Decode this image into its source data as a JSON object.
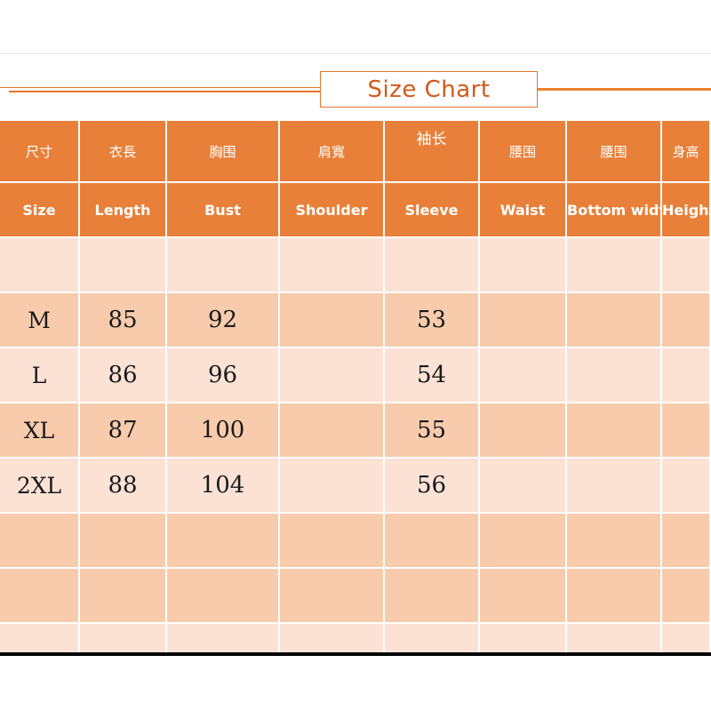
{
  "title": {
    "text": "Size Chart"
  },
  "table": {
    "header_cn": [
      "尺寸",
      "衣長",
      "胸围",
      "肩寬",
      "袖长",
      "腰围",
      "腰围",
      "身高"
    ],
    "header_en": [
      "Size",
      "Length",
      "Bust",
      "Shoulder",
      "Sleeve",
      "Waist",
      "Bottom width",
      "Height"
    ],
    "rows": [
      {
        "cells": [
          "",
          "",
          "",
          "",
          "",
          "",
          "",
          ""
        ]
      },
      {
        "cells": [
          "M",
          "85",
          "92",
          "",
          "53",
          "",
          "",
          ""
        ]
      },
      {
        "cells": [
          "L",
          "86",
          "96",
          "",
          "54",
          "",
          "",
          ""
        ]
      },
      {
        "cells": [
          "XL",
          "87",
          "100",
          "",
          "55",
          "",
          "",
          ""
        ]
      },
      {
        "cells": [
          "2XL",
          "88",
          "104",
          "",
          "56",
          "",
          "",
          ""
        ]
      },
      {
        "cells": [
          "",
          "",
          "",
          "",
          "",
          "",
          "",
          ""
        ]
      },
      {
        "cells": [
          "",
          "",
          "",
          "",
          "",
          "",
          "",
          ""
        ]
      },
      {
        "cells": [
          "",
          "",
          "",
          "",
          "",
          "",
          "",
          ""
        ]
      }
    ]
  },
  "colors": {
    "header_orange": "#E8803A",
    "row_light": "#FBE2D5",
    "row_dark": "#F7CBAC",
    "title_orange": "#D3591B",
    "rule_orange": "#E2762A",
    "bottom_border": "#000000"
  }
}
